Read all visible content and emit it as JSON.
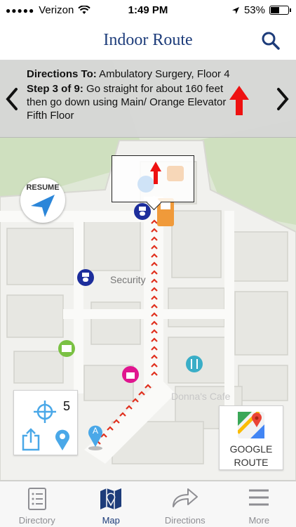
{
  "status_bar": {
    "carrier": "Verizon",
    "time": "1:49 PM",
    "battery_text": "53%",
    "battery_level": 0.53
  },
  "nav": {
    "title": "Indoor Route",
    "search_icon": "search-icon"
  },
  "directions": {
    "to_label": "Directions To:",
    "to_value": "Ambulatory Surgery, Floor 4",
    "step_label": "Step 3 of 9:",
    "step_text": "Go straight for about 160 feet then go down using Main/ Orange Elevator Fifth Floor",
    "arrow_color": "#ee1111"
  },
  "map": {
    "resume_label": "RESUME",
    "security_label": "Security",
    "cafe_label": "Donna's Cafe",
    "floor_count": "5",
    "start_marker_label": "A",
    "route_color": "#e0301e"
  },
  "google_route": {
    "line1": "GOOGLE",
    "line2": "ROUTE"
  },
  "tabs": [
    {
      "label": "Directory",
      "icon": "list-icon"
    },
    {
      "label": "Map",
      "icon": "map-icon"
    },
    {
      "label": "Directions",
      "icon": "directions-arrow-icon"
    },
    {
      "label": "More",
      "icon": "menu-icon"
    }
  ],
  "colors": {
    "brand": "#1d3c7a",
    "inactive_tab": "#8e8e93",
    "locate_blue": "#4aa8e8"
  }
}
